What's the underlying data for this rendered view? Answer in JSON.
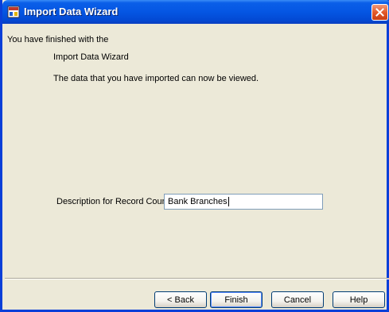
{
  "window": {
    "title": "Import Data Wizard"
  },
  "icons": {
    "app": "wizard-app-icon",
    "close": "close-icon"
  },
  "content": {
    "line1": "You have finished with the",
    "line2": "Import Data Wizard",
    "line3": "The data that you have imported can now be viewed.",
    "description_label": "Description for Record Count:",
    "description_value": "Bank Branches"
  },
  "buttons": {
    "back": "< Back",
    "finish": "Finish",
    "cancel": "Cancel",
    "help": "Help"
  },
  "colors": {
    "titlebar": "#0556e3",
    "dialog_bg": "#ece9d8",
    "close": "#e35a2b"
  }
}
